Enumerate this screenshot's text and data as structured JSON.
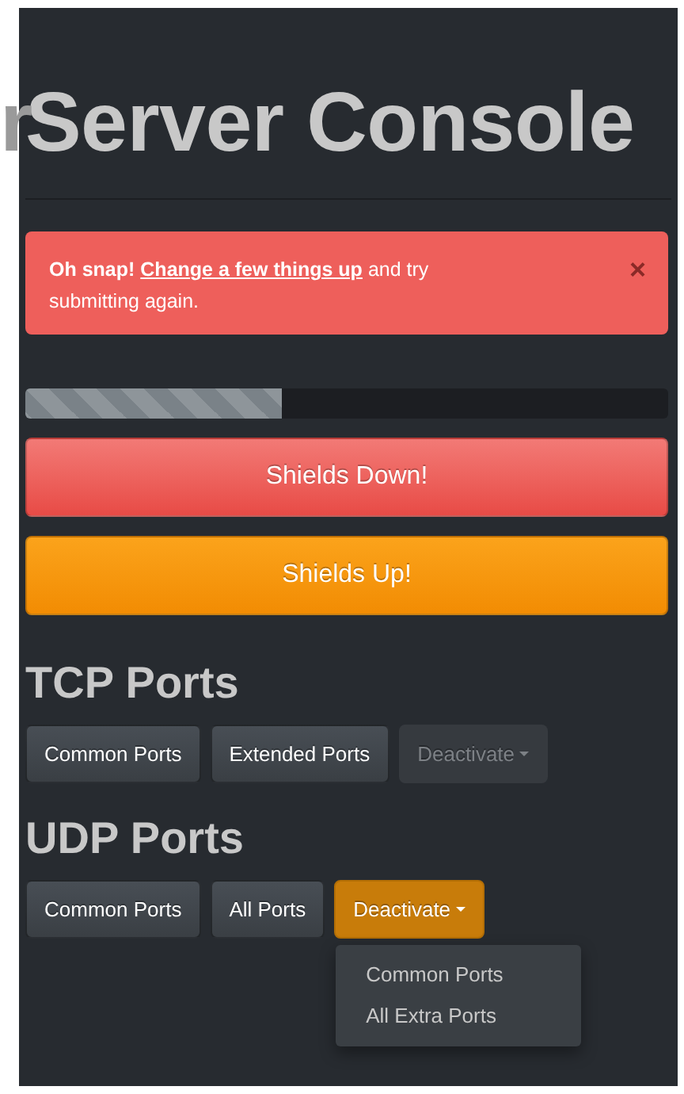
{
  "title_cut": "r",
  "title": "Server Console",
  "alert": {
    "lead": "Oh snap!",
    "link": "Change a few things up",
    "rest": "and try submitting again.",
    "close": "×"
  },
  "progress": {
    "level": 0.4,
    "striped": true
  },
  "buttons": [
    {
      "label": "Shields Down!",
      "kind": "danger"
    },
    {
      "label": "Shields Up!",
      "kind": "warning"
    }
  ],
  "sections": [
    {
      "title": "TCP Ports",
      "buttons": [
        {
          "label": "Common Ports",
          "kind": "button"
        },
        {
          "label": "Extended Ports",
          "kind": "button"
        },
        {
          "label": "Deactivate",
          "kind": "dropdown",
          "disabled": true,
          "expanded": false
        }
      ]
    },
    {
      "title": "UDP Ports",
      "buttons": [
        {
          "label": "Common Ports",
          "kind": "button"
        },
        {
          "label": "All Ports",
          "kind": "button"
        },
        {
          "label": "Deactivate",
          "kind": "dropdown",
          "disabled": false,
          "expanded": true,
          "menu": [
            "Common Ports",
            "All Extra Ports"
          ]
        }
      ]
    }
  ]
}
